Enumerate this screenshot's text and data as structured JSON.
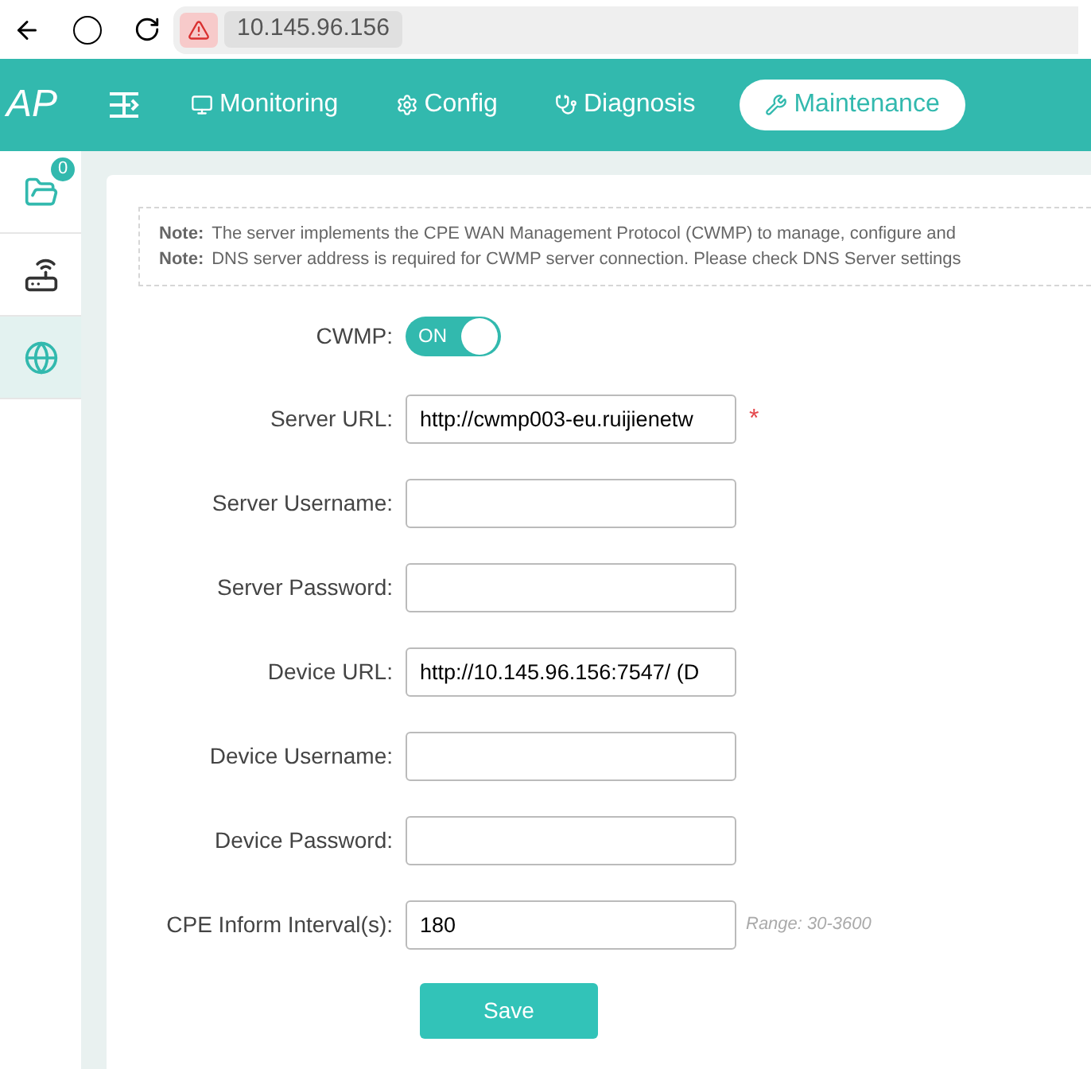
{
  "browser": {
    "address": "10.145.96.156"
  },
  "nav": {
    "logo": "AP",
    "tabs": [
      {
        "label": "Monitoring",
        "kind": "monitor",
        "selected": false
      },
      {
        "label": "Config",
        "kind": "gear",
        "selected": false
      },
      {
        "label": "Diagnosis",
        "kind": "stethoscope",
        "selected": false
      },
      {
        "label": "Maintenance",
        "kind": "tools",
        "selected": true
      }
    ]
  },
  "sidebar": {
    "items": [
      {
        "kind": "folder",
        "badge": "0",
        "selected": false
      },
      {
        "kind": "router",
        "selected": false
      },
      {
        "kind": "globe",
        "selected": true
      }
    ]
  },
  "notes": [
    {
      "label": "Note:",
      "text": "The server implements the CPE WAN Management Protocol (CWMP) to manage, configure and"
    },
    {
      "label": "Note:",
      "text": "DNS server address is required for CWMP server connection. Please check DNS Server settings"
    }
  ],
  "cwmp": {
    "label": "CWMP:",
    "toggle": "ON",
    "on": true
  },
  "fields": [
    {
      "label": "Server URL:",
      "value": "http://cwmp003-eu.ruijienetw",
      "required_mark": "*"
    },
    {
      "label": "Server Username:"
    },
    {
      "label": "Server Password:"
    },
    {
      "label": "Device URL:",
      "value": "http://10.145.96.156:7547/ (D"
    },
    {
      "label": "Device Username:"
    },
    {
      "label": "Device Password:"
    },
    {
      "label": "CPE Inform Interval(s):",
      "value": "180",
      "hint": "Range: 30-3600"
    }
  ],
  "save_button": "Save"
}
